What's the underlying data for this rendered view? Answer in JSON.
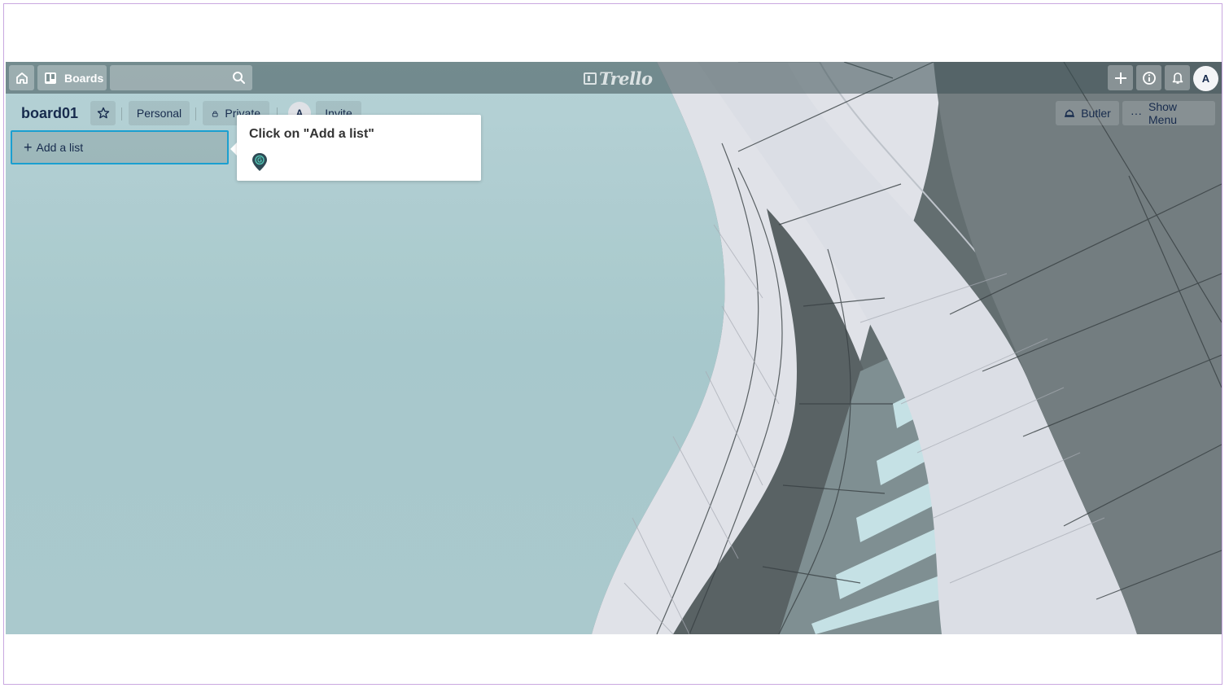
{
  "header": {
    "boards_label": "Boards",
    "search_placeholder": "",
    "logo_text": "Trello",
    "avatar_initial": "A"
  },
  "board": {
    "title": "board01",
    "team_label": "Personal",
    "visibility_label": "Private",
    "member_initial": "A",
    "invite_label": "Invite",
    "butler_label": "Butler",
    "show_menu_label": "Show Menu"
  },
  "lists": {
    "add_list_label": "Add a list"
  },
  "guide": {
    "tooltip_text": "Click on \"Add a list\""
  },
  "colors": {
    "accent": "#1b9fd0",
    "board_title": "#172b4d",
    "guide_icon": "#2f4a55"
  }
}
